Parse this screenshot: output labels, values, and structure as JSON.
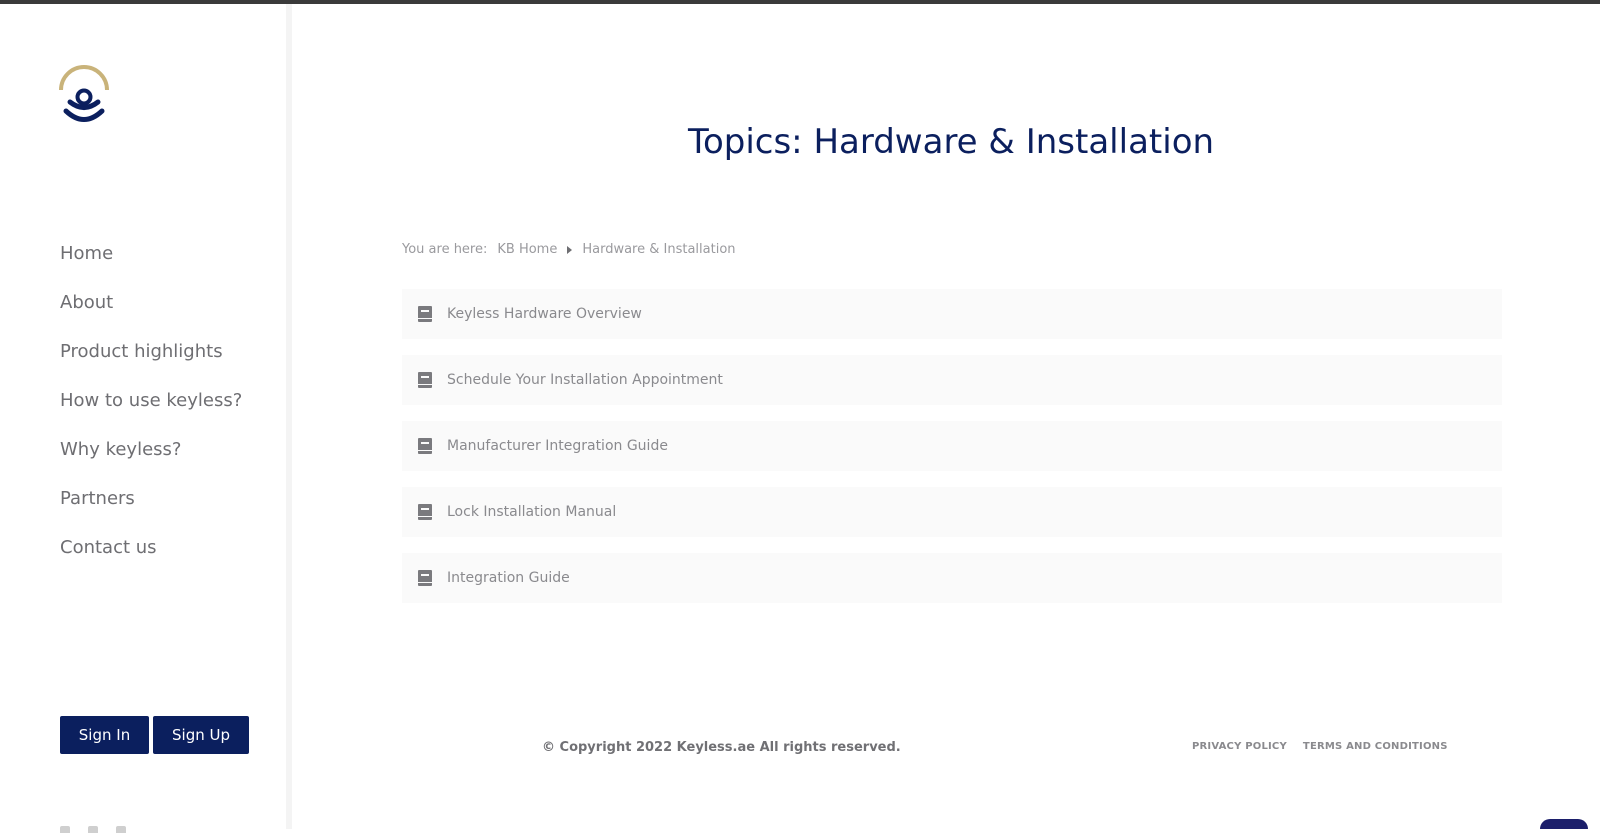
{
  "sidebar": {
    "nav": [
      {
        "label": "Home"
      },
      {
        "label": "About"
      },
      {
        "label": "Product highlights"
      },
      {
        "label": "How to use keyless?"
      },
      {
        "label": "Why keyless?"
      },
      {
        "label": "Partners"
      },
      {
        "label": "Contact us"
      }
    ],
    "sign_in_label": "Sign In",
    "sign_up_label": "Sign Up"
  },
  "main": {
    "title": "Topics: Hardware & Installation",
    "breadcrumb": {
      "prefix": "You are here:",
      "home": "KB Home",
      "current": "Hardware & Installation"
    },
    "topics": [
      {
        "label": "Keyless Hardware Overview"
      },
      {
        "label": "Schedule Your Installation Appointment"
      },
      {
        "label": "Manufacturer Integration Guide"
      },
      {
        "label": "Lock Installation Manual"
      },
      {
        "label": "Integration Guide"
      }
    ]
  },
  "footer": {
    "copyright": "© Copyright 2022 Keyless.ae All rights reserved.",
    "privacy": "PRIVACY POLICY",
    "terms": "TERMS AND CONDITIONS"
  },
  "colors": {
    "brand_navy": "#0b1f5e",
    "brand_gold": "#c9b37a"
  }
}
